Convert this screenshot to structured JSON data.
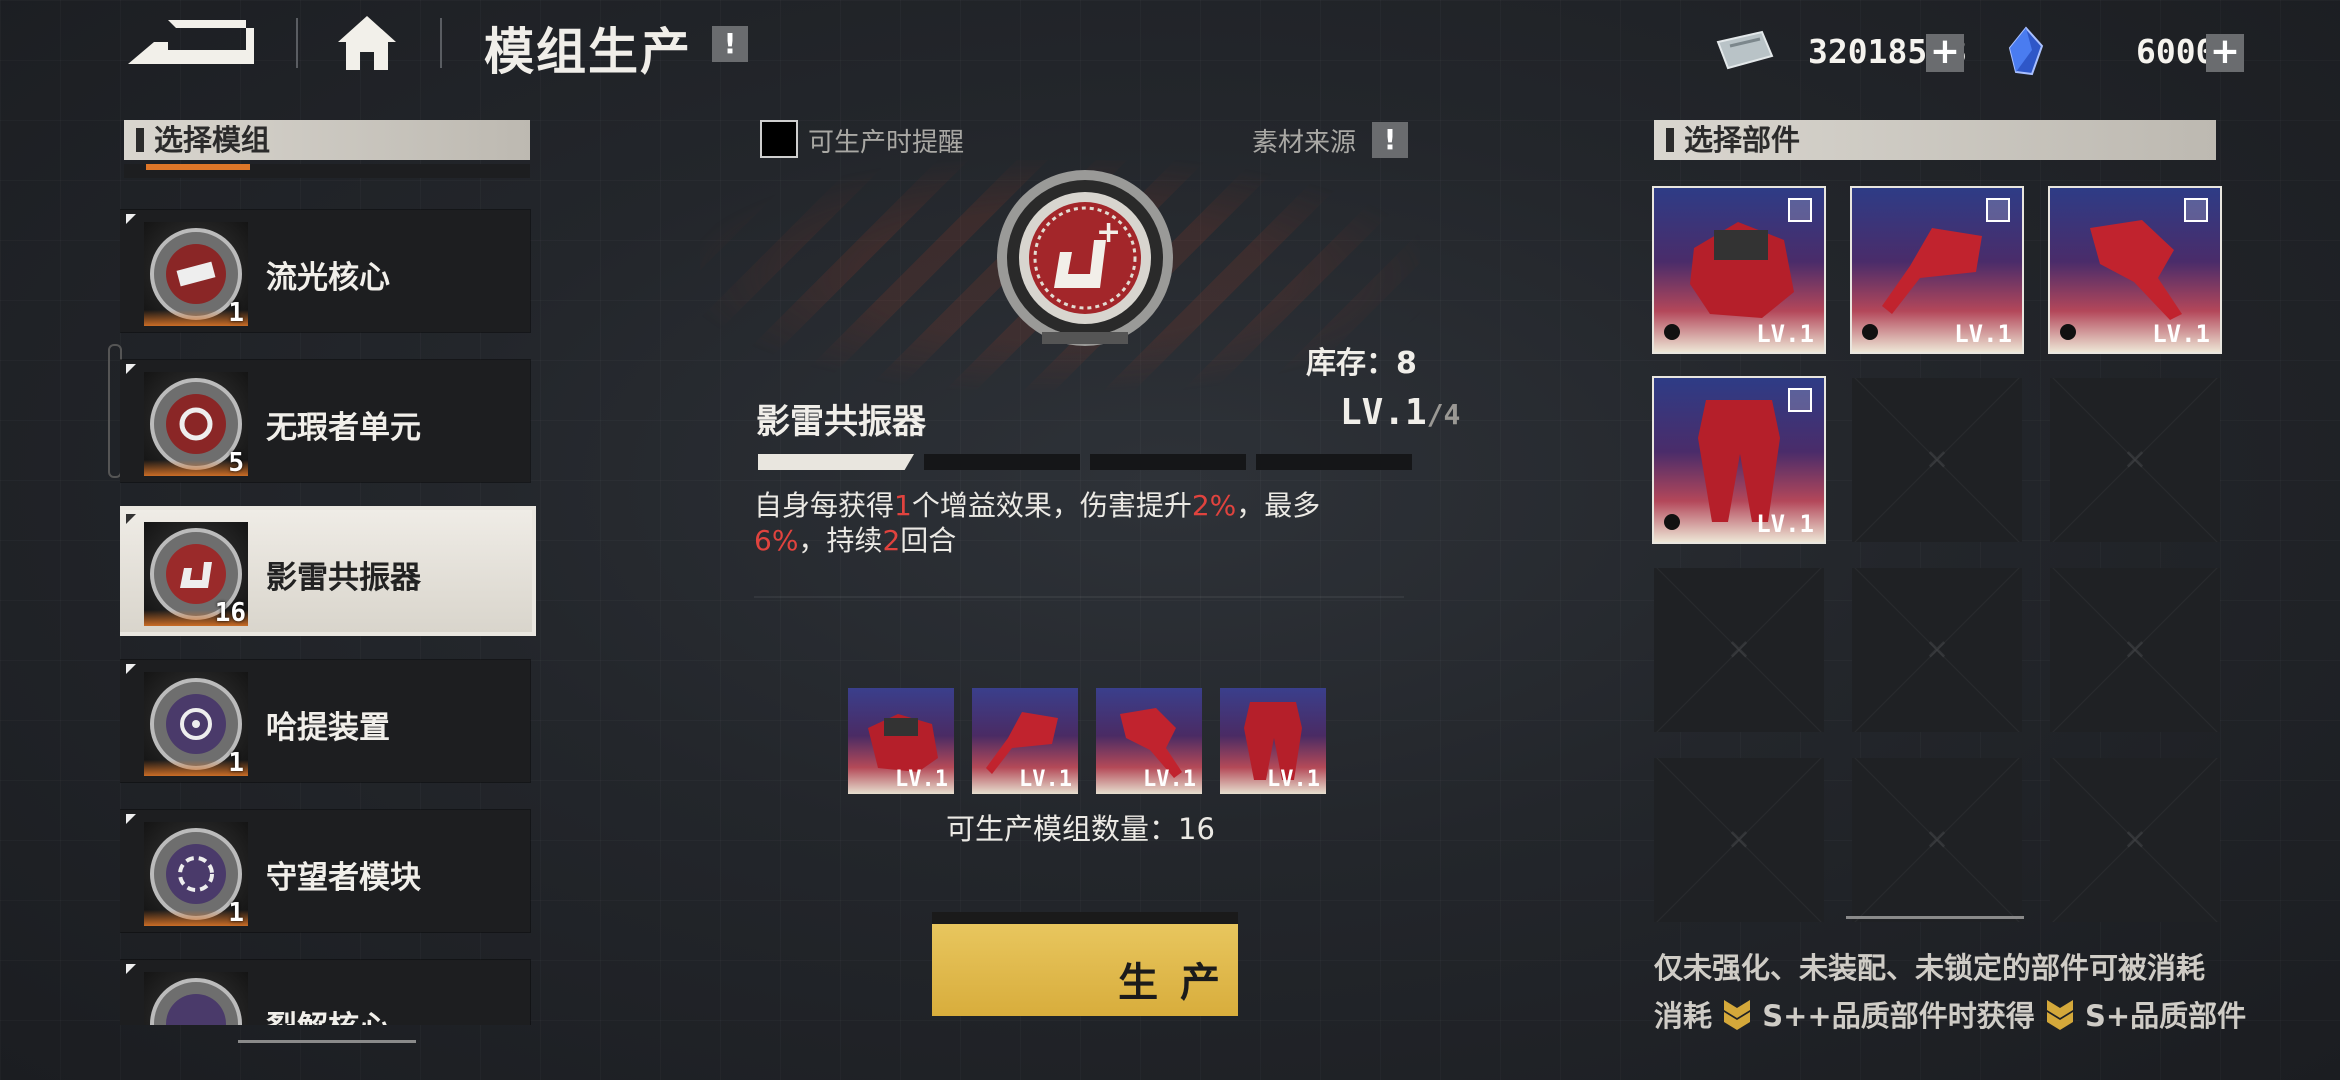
{
  "header": {
    "title": "模组生产",
    "info_badge": "!",
    "currency1": {
      "icon": "ticket-currency-icon",
      "value": "32018563",
      "plus": "+"
    },
    "currency2": {
      "icon": "crystal-currency-icon",
      "value": "6000",
      "plus": "+"
    }
  },
  "left_panel": {
    "header": "选择模组",
    "items": [
      {
        "label": "流光核心",
        "count": "1"
      },
      {
        "label": "无瑕者单元",
        "count": "5"
      },
      {
        "label": "影雷共振器",
        "count": "16",
        "selected": true
      },
      {
        "label": "哈提装置",
        "count": "1"
      },
      {
        "label": "守望者模块",
        "count": "1"
      },
      {
        "label": "裂解核心",
        "count": ""
      }
    ]
  },
  "center": {
    "remind_label": "可生产时提醒",
    "material_source": "素材来源",
    "material_badge": "!",
    "stock": "库存：8",
    "module_name": "影雷共振器",
    "level_main": "LV.1",
    "level_max": "/4",
    "level_progress": 0.25,
    "desc": {
      "p1": "自身每获得",
      "n1": "1",
      "p2": "个增益效果，伤害提升",
      "n2": "2%",
      "p3": "，最多",
      "n3": "6%",
      "p4": "，持续",
      "n4": "2",
      "p5": "回合"
    },
    "materials": [
      {
        "lv": "LV.1"
      },
      {
        "lv": "LV.1"
      },
      {
        "lv": "LV.1"
      },
      {
        "lv": "LV.1"
      }
    ],
    "producible_count": "可生产模组数量：16",
    "produce_button": "生 产"
  },
  "right_panel": {
    "header": "选择部件",
    "parts": [
      {
        "filled": true,
        "lv": "LV.1"
      },
      {
        "filled": true,
        "lv": "LV.1"
      },
      {
        "filled": true,
        "lv": "LV.1"
      },
      {
        "filled": true,
        "lv": "LV.1"
      },
      {
        "filled": false
      },
      {
        "filled": false
      },
      {
        "filled": false
      },
      {
        "filled": false
      },
      {
        "filled": false
      },
      {
        "filled": false
      },
      {
        "filled": false
      },
      {
        "filled": false
      }
    ],
    "note_line1": "仅未强化、未装配、未锁定的部件可被消耗",
    "note_line2_a": "消耗",
    "note_line2_b": "S++品质部件时获得",
    "note_line2_c": "S+品质部件"
  },
  "colors": {
    "accent_red": "#e0433e",
    "produce_yellow": "#e5c155",
    "orange_bar": "#de7628"
  }
}
